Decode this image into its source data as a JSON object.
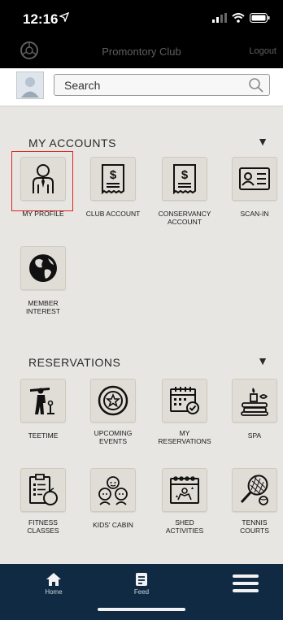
{
  "status": {
    "time": "12:16",
    "location_icon": "location-arrow-icon"
  },
  "app": {
    "title": "Promontory Club",
    "logout": "Logout"
  },
  "search": {
    "placeholder": "Search"
  },
  "sections": {
    "accounts": {
      "title": "MY ACCOUNTS",
      "items": [
        {
          "label": "MY PROFILE",
          "icon": "person-icon",
          "selected": true
        },
        {
          "label": "CLUB ACCOUNT",
          "icon": "invoice-icon"
        },
        {
          "label": "CONSERVANCY ACCOUNT",
          "icon": "invoice-icon"
        },
        {
          "label": "SCAN-IN",
          "icon": "id-card-icon"
        },
        {
          "label": "MEMBER INTEREST",
          "icon": "globe-icon"
        }
      ]
    },
    "reservations": {
      "title": "RESERVATIONS",
      "items": [
        {
          "label": "TEETIME",
          "icon": "golfer-icon"
        },
        {
          "label": "UPCOMING EVENTS",
          "icon": "star-badge-icon"
        },
        {
          "label": "MY RESERVATIONS",
          "icon": "calendar-check-icon"
        },
        {
          "label": "SPA",
          "icon": "spa-icon"
        },
        {
          "label": "FITNESS CLASSES",
          "icon": "clipboard-apple-icon"
        },
        {
          "label": "KIDS' CABIN",
          "icon": "kids-icon"
        },
        {
          "label": "SHED ACTIVITIES",
          "icon": "shed-calendar-icon"
        },
        {
          "label": "TENNIS COURTS",
          "icon": "tennis-icon"
        }
      ]
    }
  },
  "nav": {
    "home": "Home",
    "feed": "Feed"
  }
}
